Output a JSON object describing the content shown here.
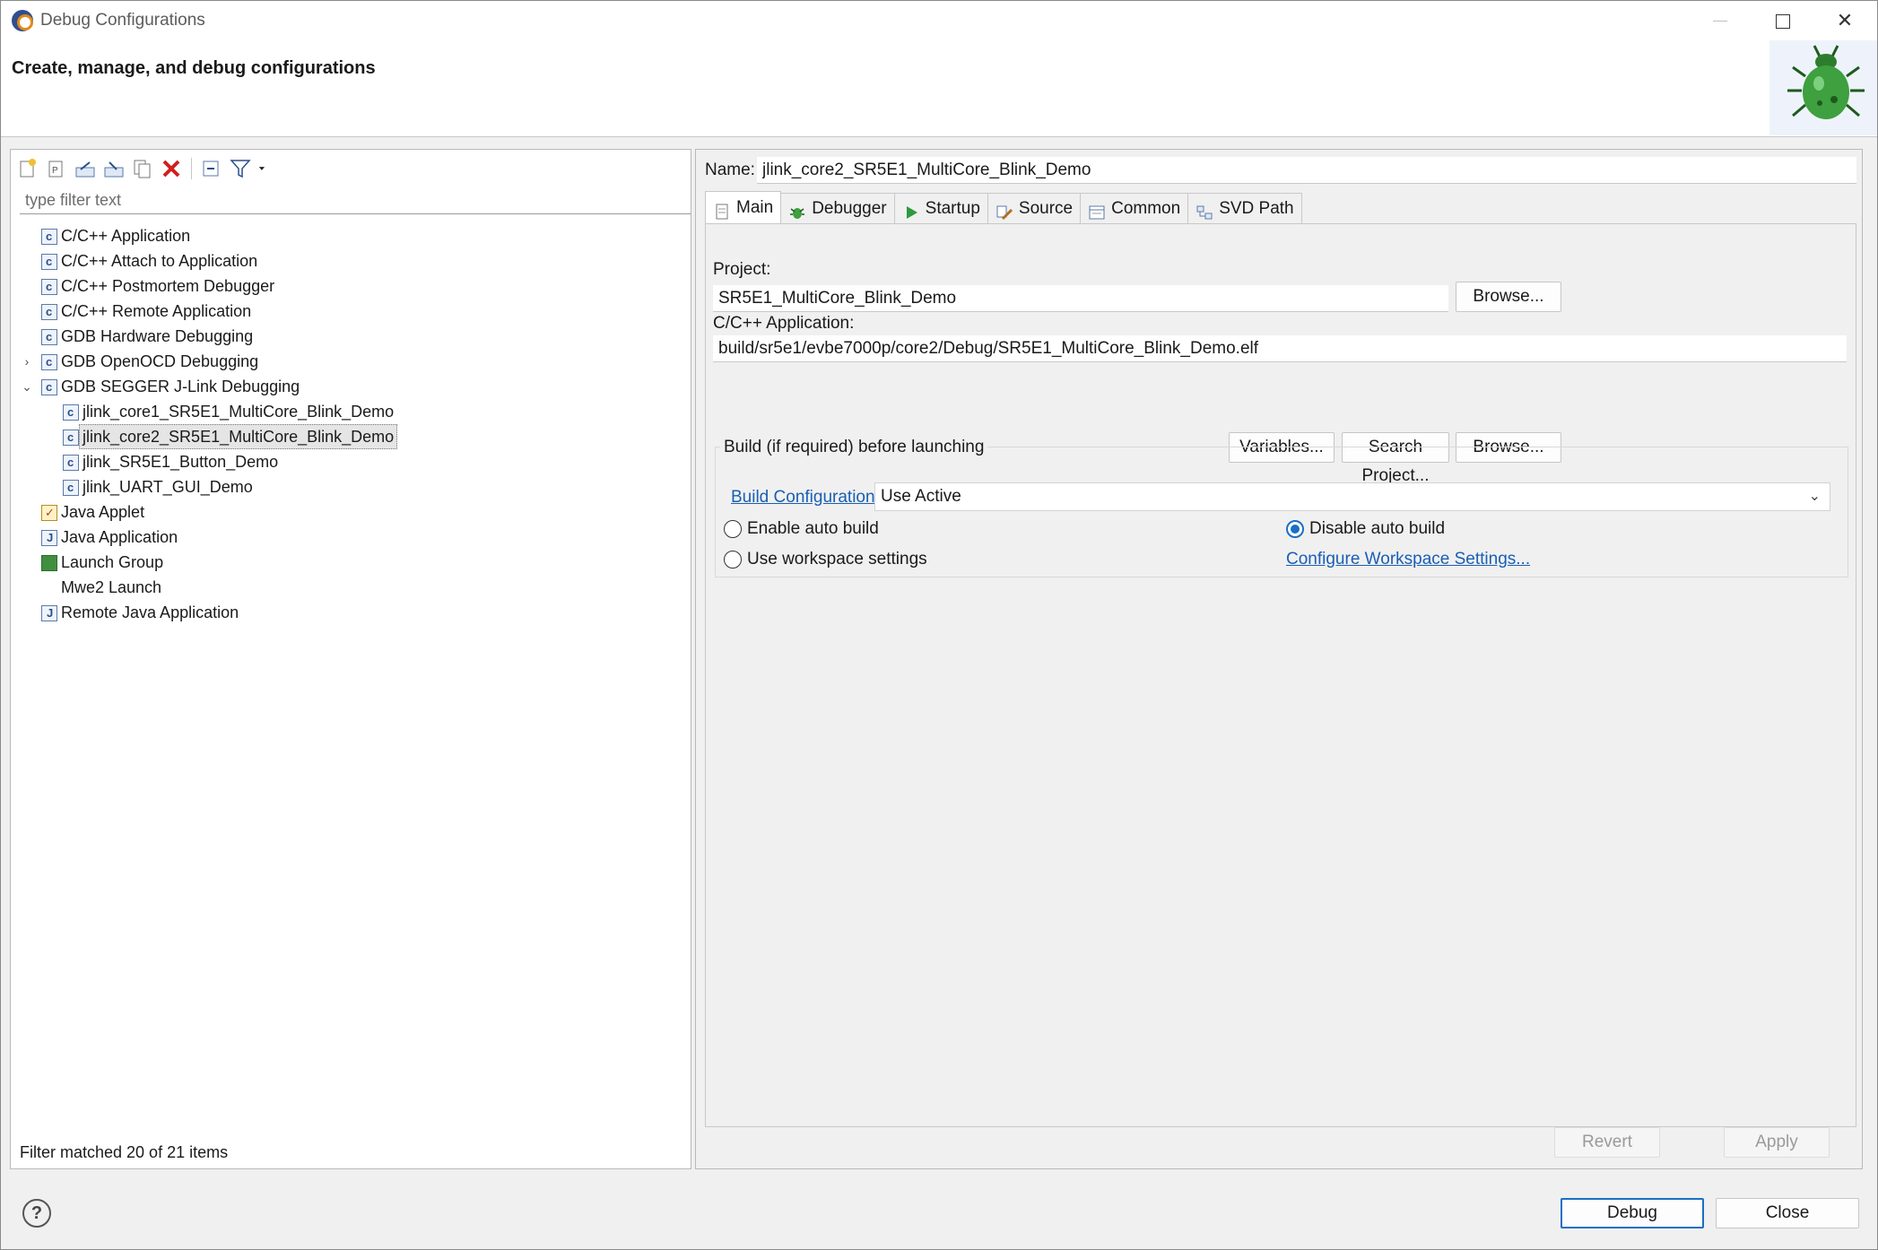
{
  "window": {
    "title": "Debug Configurations"
  },
  "banner": {
    "heading": "Create, manage, and debug configurations"
  },
  "left": {
    "filter_placeholder": "type filter text",
    "tree": [
      {
        "label": "C/C++ Application",
        "icon": "c-config-icon",
        "level": 0
      },
      {
        "label": "C/C++ Attach to Application",
        "icon": "c-config-icon",
        "level": 0
      },
      {
        "label": "C/C++ Postmortem Debugger",
        "icon": "c-config-icon",
        "level": 0
      },
      {
        "label": "C/C++ Remote Application",
        "icon": "c-config-icon",
        "level": 0
      },
      {
        "label": "GDB Hardware Debugging",
        "icon": "c-config-icon",
        "level": 0
      },
      {
        "label": "GDB OpenOCD Debugging",
        "icon": "c-config-icon",
        "level": 0,
        "twisty": ">"
      },
      {
        "label": "GDB SEGGER J-Link Debugging",
        "icon": "c-config-icon",
        "level": 0,
        "twisty": "v"
      },
      {
        "label": "jlink_core1_SR5E1_MultiCore_Blink_Demo",
        "icon": "c-config-icon",
        "level": 1
      },
      {
        "label": "jlink_core2_SR5E1_MultiCore_Blink_Demo",
        "icon": "c-config-icon",
        "level": 1,
        "selected": true
      },
      {
        "label": "jlink_SR5E1_Button_Demo",
        "icon": "c-config-icon",
        "level": 1
      },
      {
        "label": "jlink_UART_GUI_Demo",
        "icon": "c-config-icon",
        "level": 1
      },
      {
        "label": "Java Applet",
        "icon": "java-applet-icon",
        "level": 0
      },
      {
        "label": "Java Application",
        "icon": "java-app-icon",
        "level": 0
      },
      {
        "label": "Launch Group",
        "icon": "launch-group-icon",
        "level": 0
      },
      {
        "label": "Mwe2 Launch",
        "icon": "none",
        "level": 0
      },
      {
        "label": "Remote Java Application",
        "icon": "remote-java-icon",
        "level": 0
      }
    ],
    "status": "Filter matched 20 of 21 items"
  },
  "right": {
    "name_label": "Name:",
    "name_value": "jlink_core2_SR5E1_MultiCore_Blink_Demo",
    "tabs": [
      {
        "label": "Main",
        "icon": "main-tab-icon",
        "active": true
      },
      {
        "label": "Debugger",
        "icon": "debugger-tab-icon"
      },
      {
        "label": "Startup",
        "icon": "startup-tab-icon"
      },
      {
        "label": "Source",
        "icon": "source-tab-icon"
      },
      {
        "label": "Common",
        "icon": "common-tab-icon"
      },
      {
        "label": "SVD Path",
        "icon": "svd-tab-icon"
      }
    ],
    "project_label": "Project:",
    "project_value": "SR5E1_MultiCore_Blink_Demo",
    "browse1": "Browse...",
    "app_label": "C/C++ Application:",
    "app_value": "build/sr5e1/evbe7000p/core2/Debug/SR5E1_MultiCore_Blink_Demo.elf",
    "variables": "Variables...",
    "search_project": "Search Project...",
    "browse2": "Browse...",
    "build_group_title": "Build (if required) before launching",
    "build_config_link": "Build Configuration:",
    "build_config_value": "Use Active",
    "enable_auto_build": "Enable auto build",
    "disable_auto_build": "Disable auto build",
    "use_workspace": "Use workspace settings",
    "configure_workspace": "Configure Workspace Settings...",
    "selected_radio": "disable_auto_build",
    "revert": "Revert",
    "apply": "Apply"
  },
  "footer": {
    "debug": "Debug",
    "close": "Close",
    "help": "?"
  },
  "colors": {
    "accent": "#1a6fc4",
    "link": "#1a5fb4"
  }
}
